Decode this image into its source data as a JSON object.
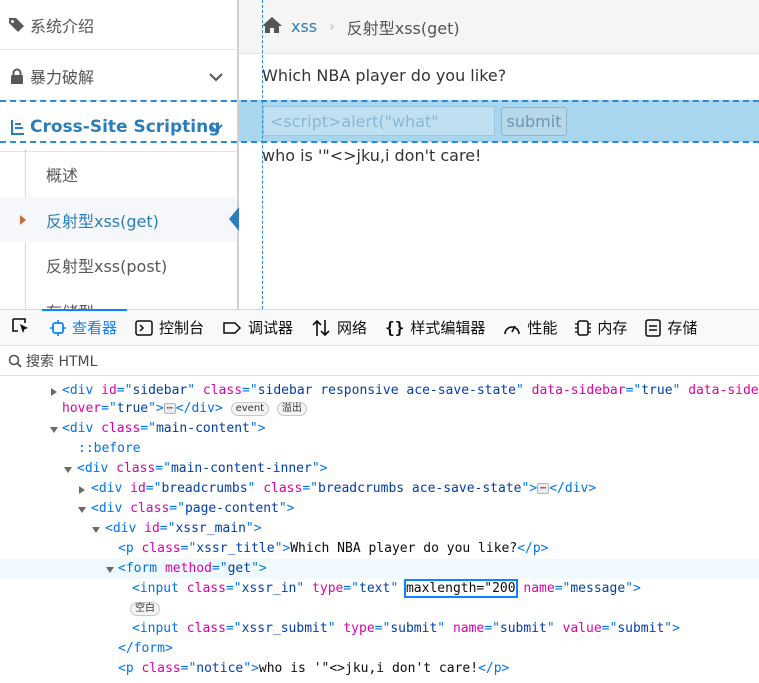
{
  "sidebar": {
    "items": [
      {
        "label": "系统介绍",
        "icon": "tags-icon"
      },
      {
        "label": "暴力破解",
        "icon": "lock-icon"
      },
      {
        "label": "Cross-Site Scripting",
        "icon": "list-icon"
      }
    ],
    "subitems": [
      {
        "label": "概述"
      },
      {
        "label": "反射型xss(get)"
      },
      {
        "label": "反射型xss(post)"
      },
      {
        "label": "存储型xss"
      }
    ]
  },
  "breadcrumb": {
    "link": "xss",
    "current": "反射型xss(get)"
  },
  "page": {
    "title": "Which NBA player do you like?",
    "input_value": "<script>alert(\"what\"",
    "submit_label": "submit",
    "notice": "who is '\"<>jku,i don't care!"
  },
  "devtools": {
    "tabs": [
      {
        "label": "查看器",
        "icon": "inspector-icon"
      },
      {
        "label": "控制台",
        "icon": "console-icon"
      },
      {
        "label": "调试器",
        "icon": "debugger-icon"
      },
      {
        "label": "网络",
        "icon": "network-icon"
      },
      {
        "label": "样式编辑器",
        "icon": "style-editor-icon"
      },
      {
        "label": "性能",
        "icon": "performance-icon"
      },
      {
        "label": "内存",
        "icon": "memory-icon"
      },
      {
        "label": "存储",
        "icon": "storage-icon"
      }
    ],
    "search_placeholder": "搜索 HTML",
    "badges": {
      "event": "event",
      "overflow": "溢出",
      "empty": "空白"
    },
    "ellipsis": "⋯"
  }
}
